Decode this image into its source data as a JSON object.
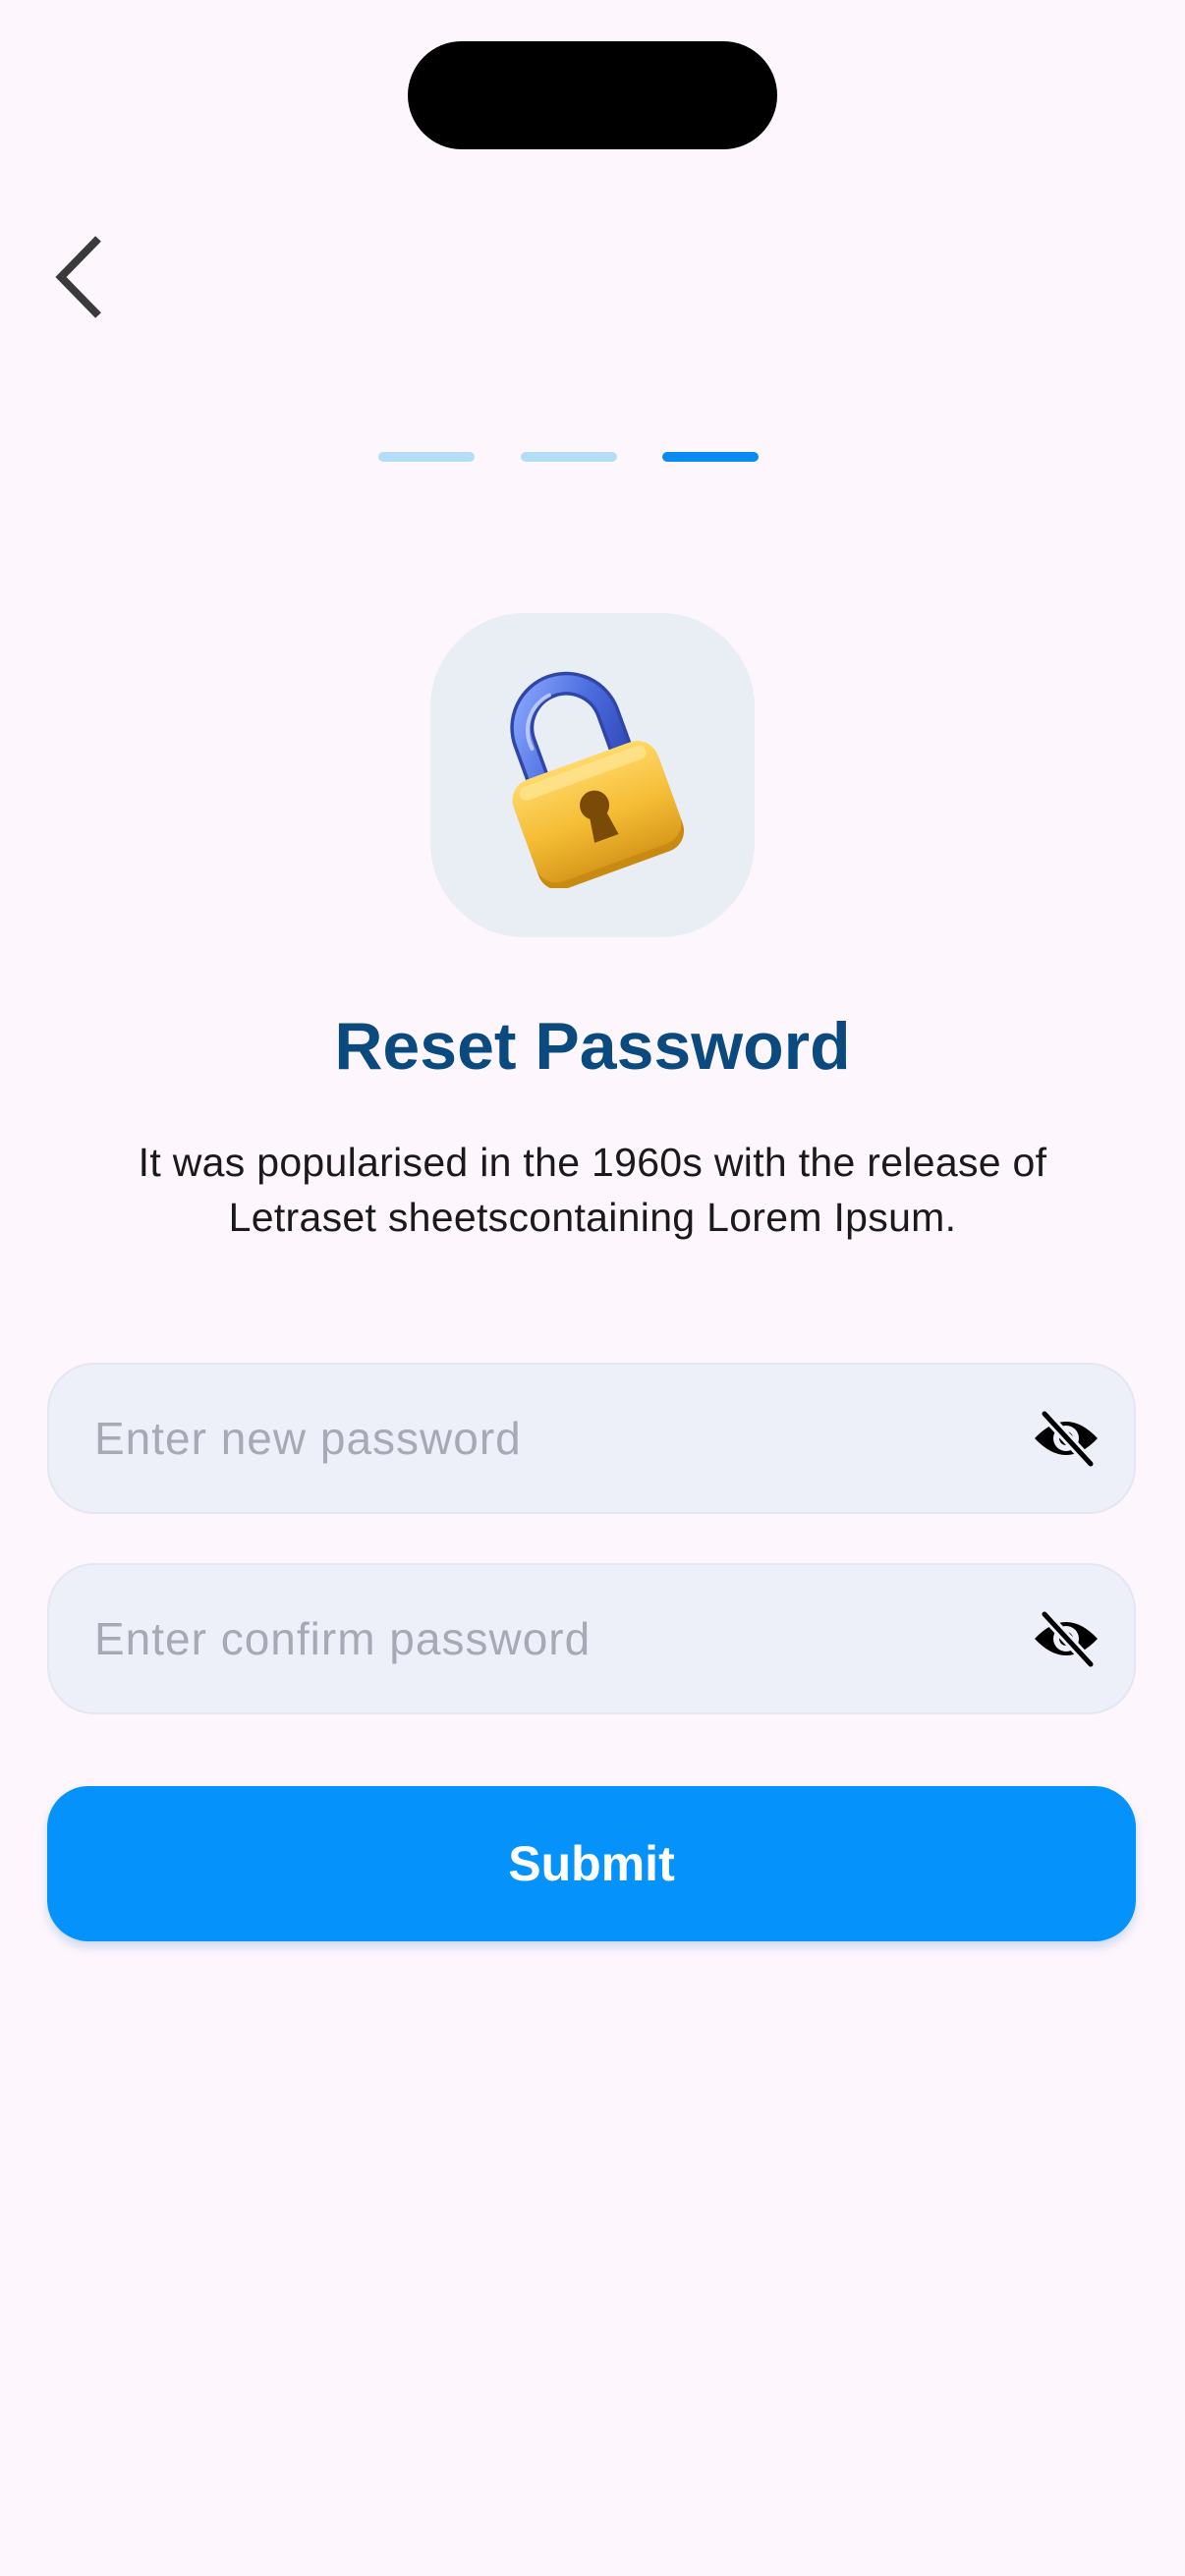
{
  "screen": {
    "title": "Reset Password",
    "description": "It was popularised in the 1960s with the release of Letraset sheetscontaining Lorem Ipsum."
  },
  "progress": {
    "total_steps": 3,
    "current_step": 3
  },
  "icons": {
    "back": "chevron-left-icon",
    "illustration": "padlock-icon",
    "visibility": "eye-off-icon"
  },
  "form": {
    "new_password": {
      "value": "",
      "placeholder": "Enter new password"
    },
    "confirm_password": {
      "value": "",
      "placeholder": "Enter confirm password"
    },
    "submit_label": "Submit"
  },
  "colors": {
    "background": "#fdf6fd",
    "title": "#0a4a7e",
    "accent": "#0593fb",
    "step_inactive": "#b3def6",
    "field_background": "#edeff9"
  }
}
